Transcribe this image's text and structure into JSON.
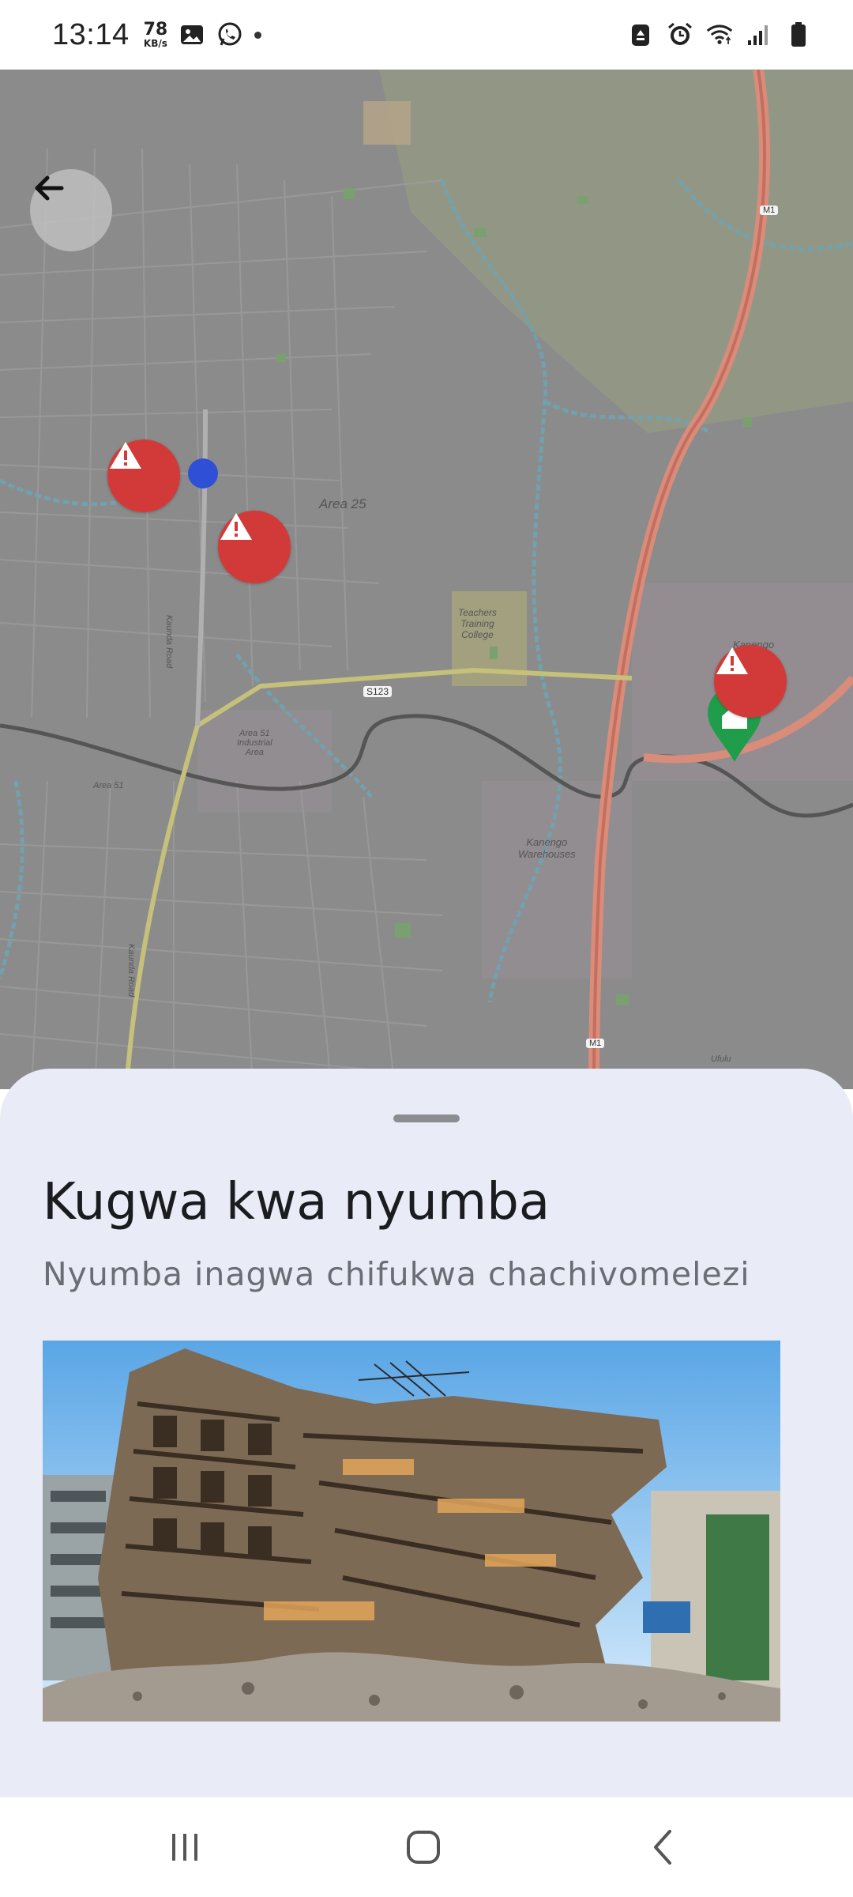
{
  "status_bar": {
    "time": "13:14",
    "net_speed_value": "78",
    "net_speed_unit": "KB/s"
  },
  "map": {
    "labels": {
      "area_25": "Area 25",
      "teachers_college": "Teachers\nTraining\nCollege",
      "kaunda_road": "Kaunda Road",
      "kaunda_road_2": "Kaunda Road",
      "area_51_industrial": "Area 51\nIndustrial\nArea",
      "area_51": "Area 51",
      "s123": "S123",
      "m1_top": "M1",
      "m1_bottom": "M1",
      "kanengo": "Kanengo",
      "kanengo_warehouses": "Kanengo\nWarehouses",
      "ufulu": "Ufulu"
    }
  },
  "sheet": {
    "title": "Kugwa kwa nyumba",
    "subtitle": "Nyumba inagwa chifukwa chachivomelezi"
  },
  "colors": {
    "warning_marker": "#d23a3a",
    "location_dot": "#2f4fd6",
    "home_marker": "#1f9d4a",
    "sheet_bg": "#e9ecf6"
  }
}
